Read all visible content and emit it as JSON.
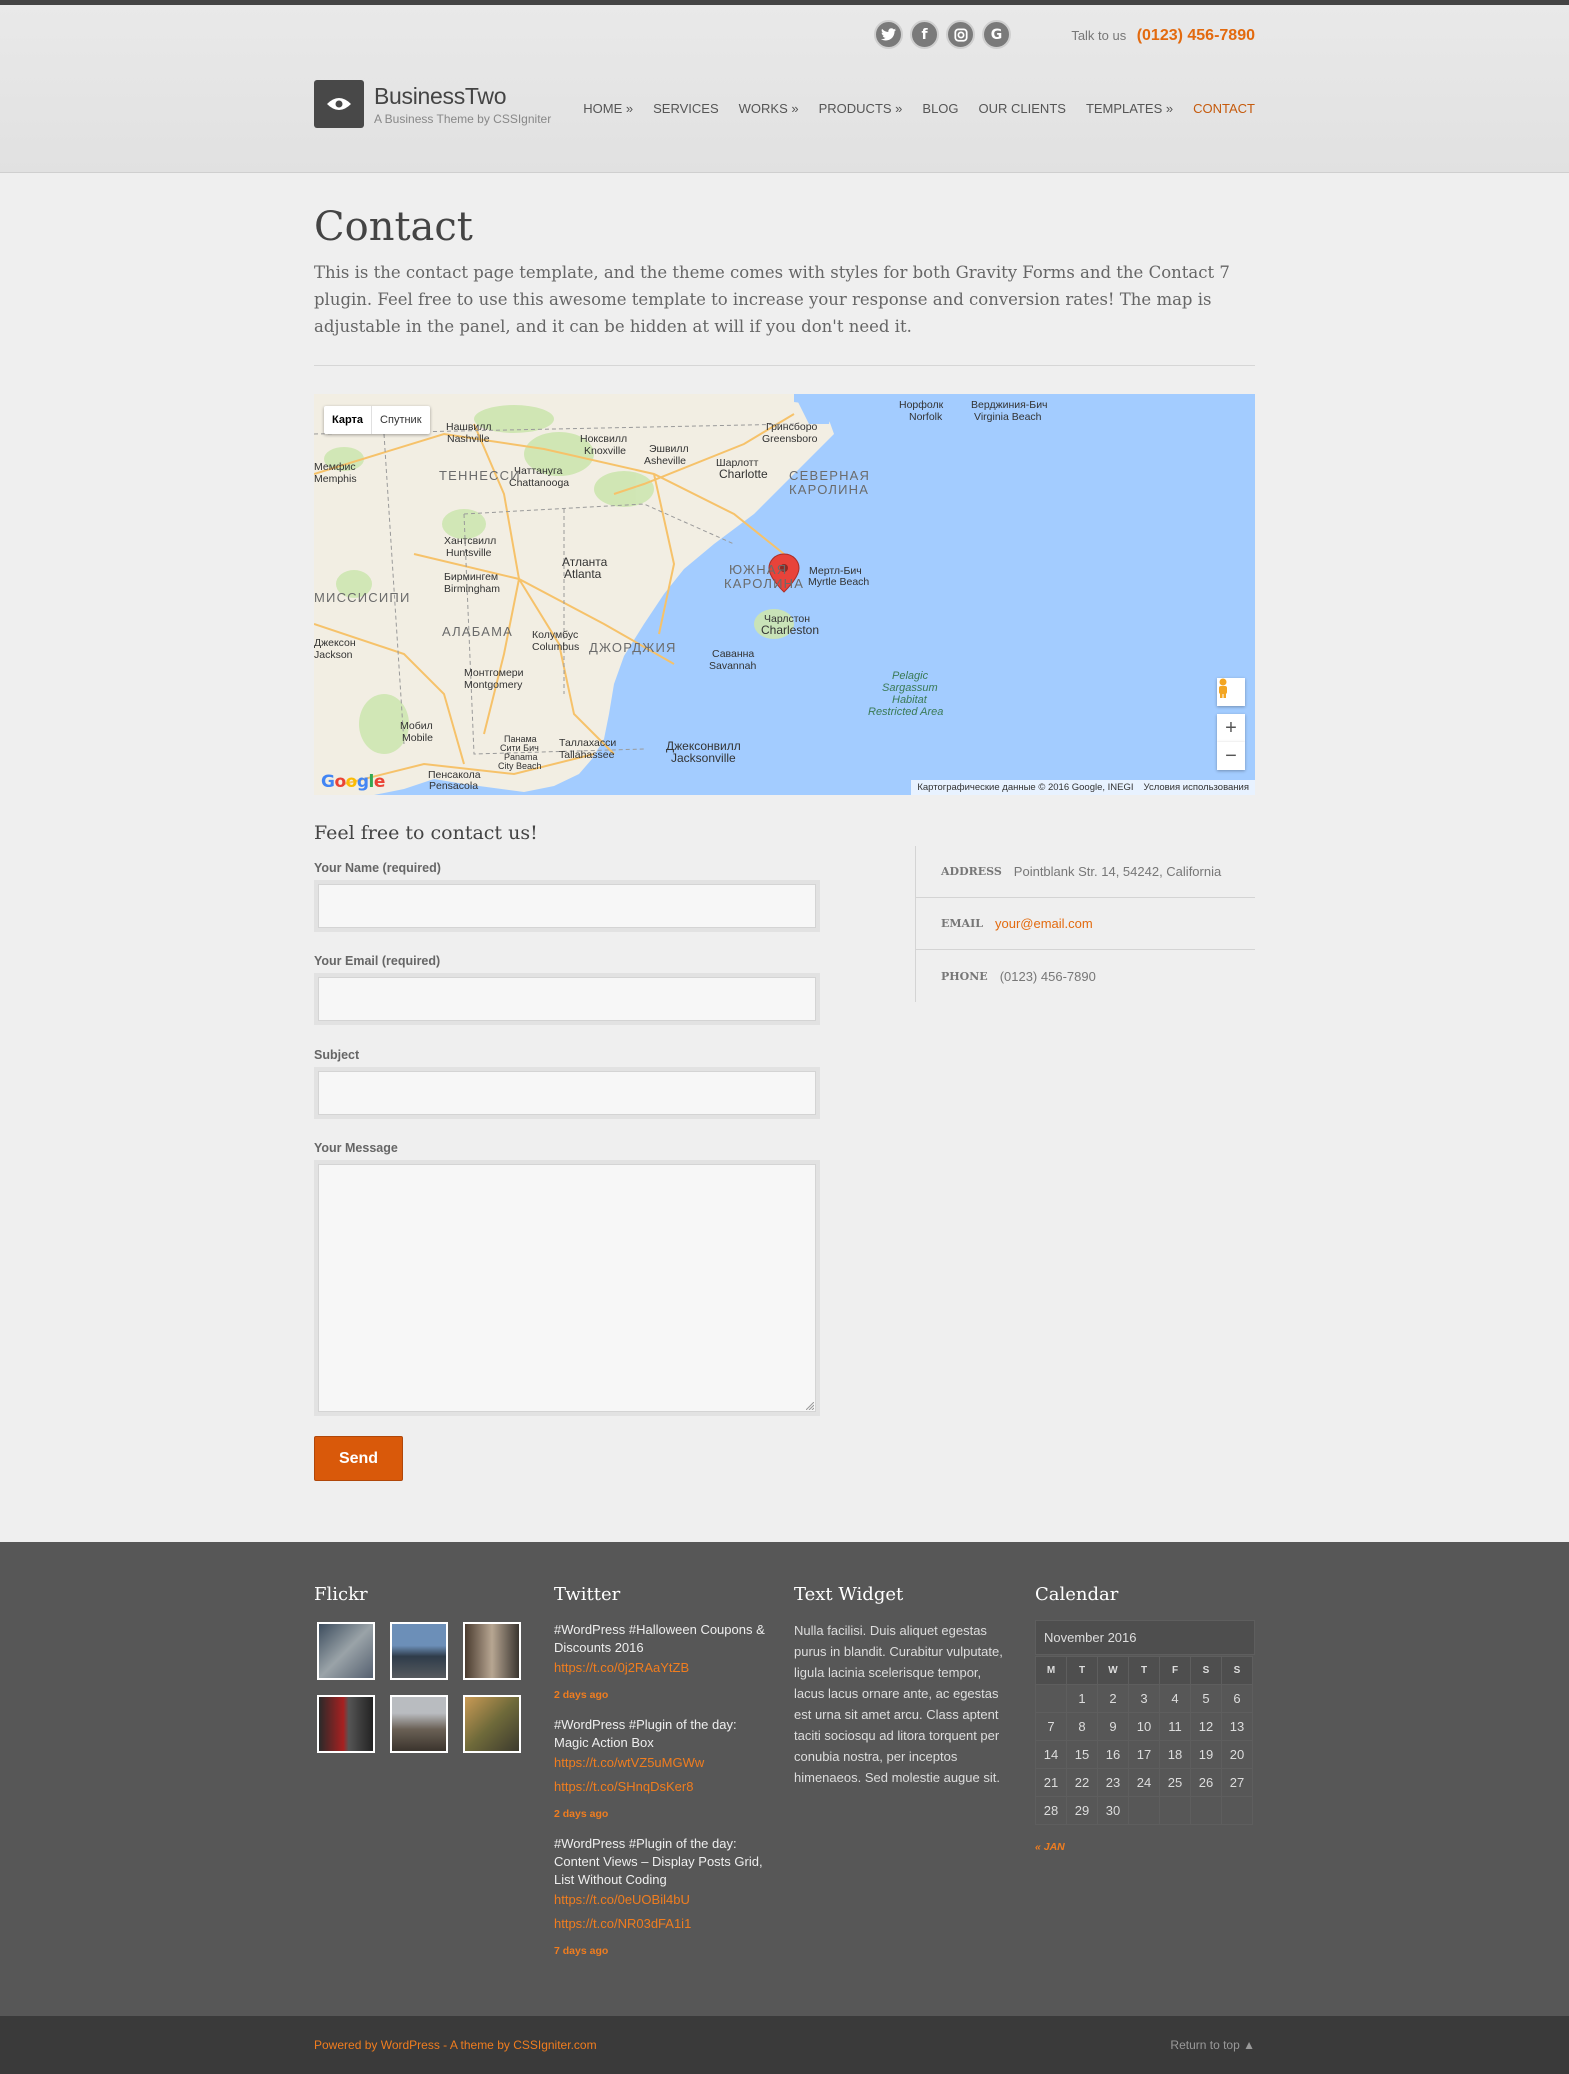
{
  "header": {
    "talk_label": "Talk to us",
    "phone": "(0123) 456-7890",
    "site_title": "BusinessTwo",
    "site_description": "A Business Theme by CSSIgniter",
    "social": [
      "twitter-icon",
      "facebook-icon",
      "instagram-icon",
      "google-icon"
    ],
    "nav": [
      "HOME »",
      "SERVICES",
      "WORKS »",
      "PRODUCTS »",
      "BLOG",
      "OUR CLIENTS",
      "TEMPLATES »",
      "CONTACT"
    ],
    "active_nav": "CONTACT"
  },
  "page": {
    "title": "Contact",
    "intro": "This is the contact page template, and the theme comes with styles for both Gravity Forms and the Contact 7 plugin. Feel free to use this awesome template to increase your response and conversion rates! The map is adjustable in the panel, and it can be hidden at will if you don't need it."
  },
  "map": {
    "type_map": "Карта",
    "type_satellite": "Спутник",
    "attribution": "Картографические данные © 2016 Google, INEGI",
    "terms": "Условия использования",
    "zoom_in": "+",
    "zoom_out": "−",
    "labels": {
      "nashville": "Нашвилл",
      "nashville_en": "Nashville",
      "knoxville": "Ноксвилл",
      "knoxville_en": "Knoxville",
      "greensboro": "Гринсборо",
      "greensboro_en": "Greensboro",
      "norfolk": "Норфолк",
      "norfolk_en": "Norfolk",
      "virginia_beach": "Верджиния-Бич",
      "virginia_beach_en": "Virginia Beach",
      "tennessee": "ТЕННЕССИ",
      "asheville": "Эшвилл",
      "asheville_en": "Asheville",
      "charlotte": "Шарлотт",
      "charlotte_en": "Charlotte",
      "north_carolina_1": "СЕВЕРНАЯ",
      "north_carolina_2": "КАРОЛИНА",
      "memphis": "Мемфис",
      "memphis_en": "Memphis",
      "chattanooga": "Чаттануга",
      "chattanooga_en": "Chattanooga",
      "huntsville": "Хантсвилл",
      "huntsville_en": "Huntsville",
      "birmingham": "Бирмингем",
      "birmingham_en": "Birmingham",
      "atlanta": "Атланта",
      "atlanta_en": "Atlanta",
      "south_carolina_1": "ЮЖНАЯ",
      "south_carolina_2": "КАРОЛИНА",
      "myrtle_beach": "Мертл-Бич",
      "myrtle_beach_en": "Myrtle Beach",
      "mississippi": "МИССИСИПИ",
      "charleston": "Чарлстон",
      "charleston_en": "Charleston",
      "alabama": "АЛАБАМА",
      "columbus": "Колумбус",
      "columbus_en": "Columbus",
      "georgia": "ДЖОРДЖИЯ",
      "jackson": "Джексон",
      "jackson_en": "Jackson",
      "savannah": "Саванна",
      "savannah_en": "Savannah",
      "montgomery": "Монтгомери",
      "montgomery_en": "Montgomery",
      "pelagic_1": "Pelagic",
      "pelagic_2": "Sargassum",
      "pelagic_3": "Habitat",
      "pelagic_4": "Restricted Area",
      "mobile": "Мобил",
      "mobile_en": "Mobile",
      "panama": "Панама",
      "panama_2": "Сити Бич",
      "panama_en": "Panama",
      "panama_en_2": "City Beach",
      "tallahassee": "Таллахасси",
      "tallahassee_en": "Tallahassee",
      "jacksonville": "Джексонвилл",
      "jacksonville_en": "Jacksonville",
      "pensacola": "Пенсакола",
      "pensacola_en": "Pensacola"
    }
  },
  "form": {
    "title": "Feel free to contact us!",
    "name_label": "Your Name (required)",
    "email_label": "Your Email (required)",
    "subject_label": "Subject",
    "message_label": "Your Message",
    "send_label": "Send"
  },
  "contact_info": {
    "address_key": "ADDRESS",
    "address_val": "Pointblank Str. 14, 54242, California",
    "email_key": "EMAIL",
    "email_val": "your@email.com",
    "phone_key": "PHONE",
    "phone_val": "(0123) 456-7890"
  },
  "footer": {
    "flickr_title": "Flickr",
    "twitter_title": "Twitter",
    "text_title": "Text Widget",
    "calendar_title": "Calendar",
    "tweets": [
      {
        "text": "#WordPress #Halloween Coupons & Discounts 2016",
        "links": [
          "https://t.co/0j2RAaYtZB"
        ],
        "ago": "2 days ago"
      },
      {
        "text": "#WordPress #Plugin of the day: Magic Action Box",
        "links": [
          "https://t.co/wtVZ5uMGWw",
          "https://t.co/SHnqDsKer8"
        ],
        "ago": "2 days ago"
      },
      {
        "text": "#WordPress #Plugin of the day: Content Views – Display Posts Grid, List Without Coding",
        "links": [
          "https://t.co/0eUOBil4bU",
          "https://t.co/NR03dFA1i1"
        ],
        "ago": "7 days ago"
      }
    ],
    "text_widget": "Nulla facilisi. Duis aliquet egestas purus in blandit. Curabitur vulputate, ligula lacinia scelerisque tempor, lacus lacus ornare ante, ac egestas est urna sit amet arcu. Class aptent taciti sociosqu ad litora torquent per conubia nostra, per inceptos himenaeos. Sed molestie augue sit.",
    "calendar": {
      "month": "November 2016",
      "weekdays": [
        "M",
        "T",
        "W",
        "T",
        "F",
        "S",
        "S"
      ],
      "cells": [
        "",
        "1",
        "2",
        "3",
        "4",
        "5",
        "6",
        "7",
        "8",
        "9",
        "10",
        "11",
        "12",
        "13",
        "14",
        "15",
        "16",
        "17",
        "18",
        "19",
        "20",
        "21",
        "22",
        "23",
        "24",
        "25",
        "26",
        "27",
        "28",
        "29",
        "30",
        "",
        "",
        "",
        ""
      ],
      "prev": "« JAN"
    },
    "powered": "Powered by WordPress - A theme by CSSIgniter.com",
    "return_top": "Return to top ▲"
  },
  "colors": {
    "accent": "#e36a0e",
    "footer_bg": "#575757",
    "water": "#a3ccff"
  }
}
